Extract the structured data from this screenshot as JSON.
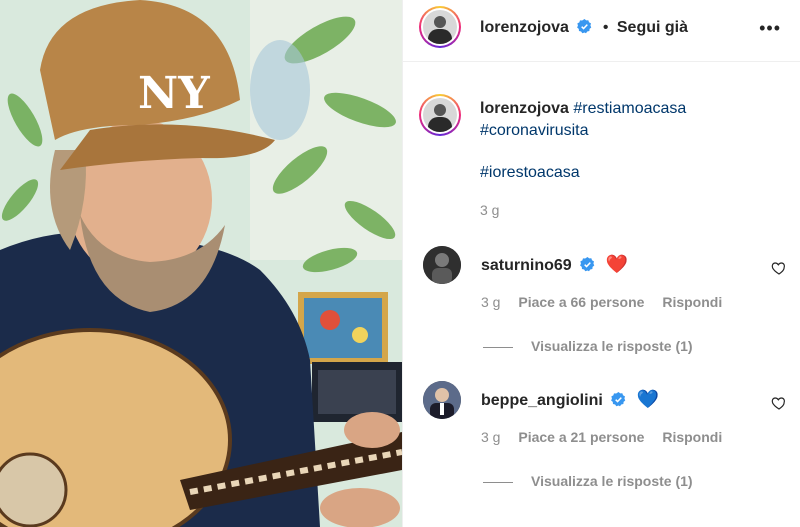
{
  "post": {
    "author": "lorenzojova",
    "separator": "•",
    "follow_status": "Segui già",
    "more_icon": "more-horizontal-icon"
  },
  "caption": {
    "username": "lorenzojova",
    "hashtag_1": "#restiamoacasa",
    "hashtag_2": "#coronavirusita",
    "hashtag_3": "#iorestoacasa",
    "time": "3 g"
  },
  "comments": [
    {
      "username": "saturnino69",
      "text": "❤️",
      "time": "3 g",
      "likes": "Piace a 66 persone",
      "reply": "Rispondi",
      "view_replies": "Visualizza le risposte (1)"
    },
    {
      "username": "beppe_angiolini",
      "text": "💙",
      "time": "3 g",
      "likes": "Piace a 21 persone",
      "reply": "Rispondi",
      "view_replies": "Visualizza le risposte (1)"
    }
  ],
  "colors": {
    "hashtag": "#00376b",
    "verified": "#3897f0",
    "meta_gray": "#8e8e8e",
    "text": "#262626"
  }
}
